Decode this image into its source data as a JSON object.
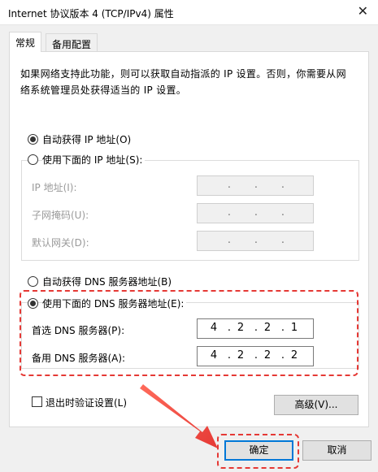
{
  "window": {
    "title": "Internet 协议版本 4 (TCP/IPv4) 属性",
    "close_glyph": "✕"
  },
  "tabs": [
    {
      "label": "常规",
      "active": true
    },
    {
      "label": "备用配置",
      "active": false
    }
  ],
  "general": {
    "description_line1": "如果网络支持此功能，则可以获取自动指派的 IP 设置。否则，你需要从网",
    "description_line2": "络系统管理员处获得适当的 IP 设置。",
    "ip_auto": {
      "label": "自动获得 IP 地址(O)",
      "selected": true
    },
    "ip_manual": {
      "label": "使用下面的 IP 地址(S):",
      "selected": false
    },
    "ip_fields": [
      {
        "label": "IP 地址(I):",
        "octets": [
          "",
          "",
          "",
          ""
        ]
      },
      {
        "label": "子网掩码(U):",
        "octets": [
          "",
          "",
          "",
          ""
        ]
      },
      {
        "label": "默认网关(D):",
        "octets": [
          "",
          "",
          "",
          ""
        ]
      }
    ],
    "dns_auto": {
      "label": "自动获得 DNS 服务器地址(B)",
      "selected": false
    },
    "dns_manual": {
      "label": "使用下面的 DNS 服务器地址(E):",
      "selected": true
    },
    "dns_fields": [
      {
        "label": "首选 DNS 服务器(P):",
        "octets": [
          "4",
          "2",
          "2",
          "1"
        ]
      },
      {
        "label": "备用 DNS 服务器(A):",
        "octets": [
          "4",
          "2",
          "2",
          "2"
        ]
      }
    ],
    "validate": {
      "label": "退出时验证设置(L)",
      "checked": false
    },
    "advanced_label": "高级(V)..."
  },
  "footer": {
    "ok_label": "确定",
    "cancel_label": "取消"
  },
  "annotation_color": "#e53935"
}
